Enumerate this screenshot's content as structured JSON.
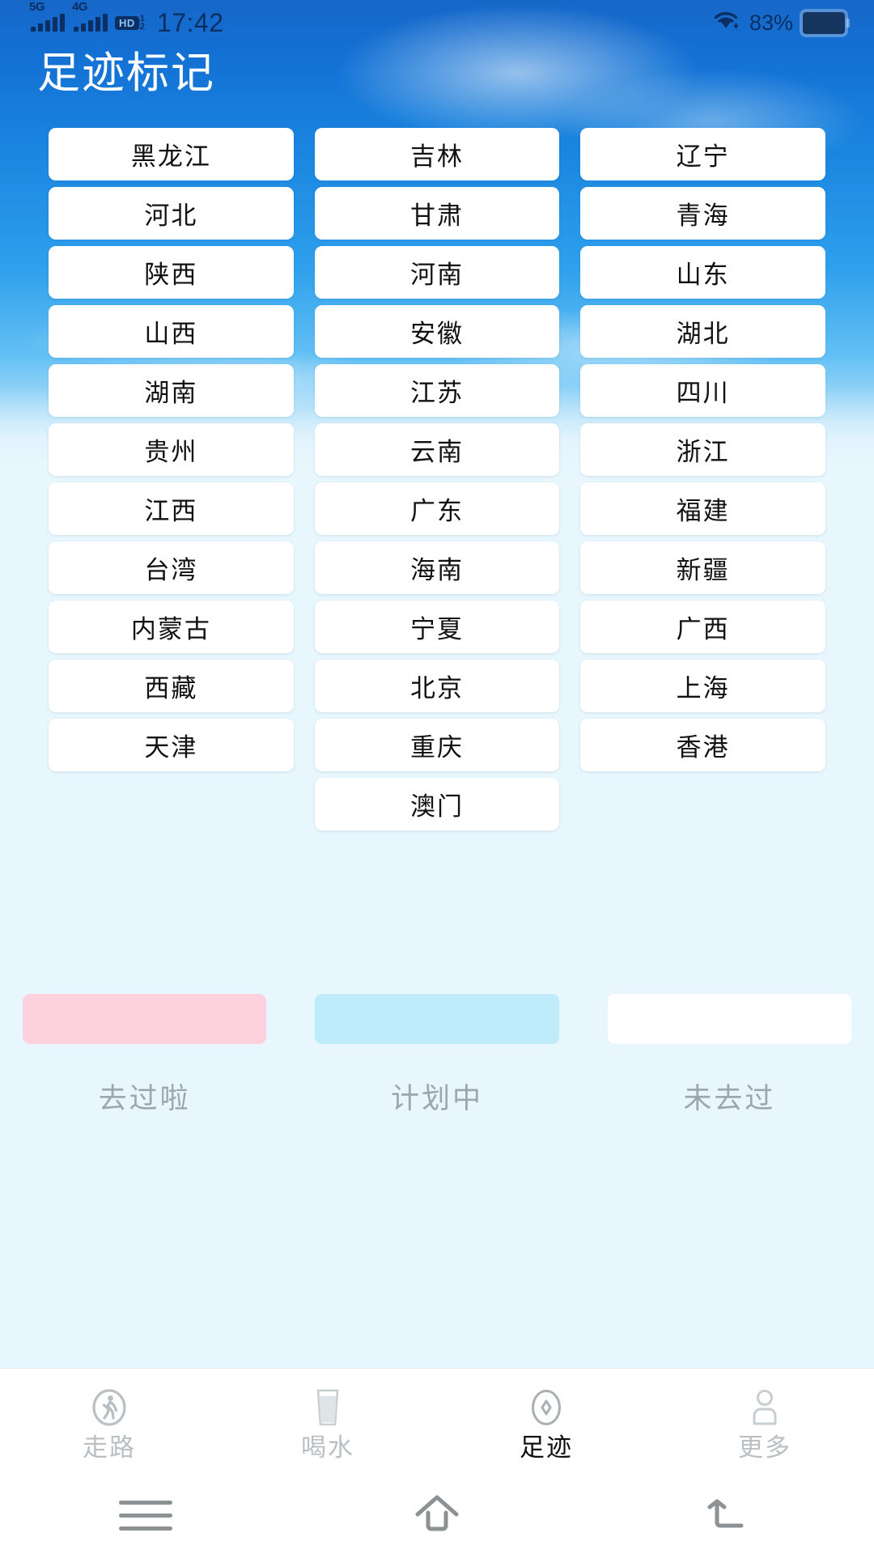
{
  "status_bar": {
    "network_5g": "5G",
    "network_4g": "4G",
    "hd_badge": "HD",
    "hd_sub_top": "1",
    "hd_sub_bottom": "2",
    "time": "17:42",
    "battery_percent": "83%",
    "wifi_icon": "wifi-icon",
    "battery_icon": "battery-icon"
  },
  "header": {
    "title": "足迹标记"
  },
  "grid": {
    "rows": [
      [
        {
          "label": "黑龙江",
          "state": "unvisited"
        },
        {
          "label": "吉林",
          "state": "unvisited"
        },
        {
          "label": "辽宁",
          "state": "unvisited"
        }
      ],
      [
        {
          "label": "河北",
          "state": "unvisited"
        },
        {
          "label": "甘肃",
          "state": "unvisited"
        },
        {
          "label": "青海",
          "state": "unvisited"
        }
      ],
      [
        {
          "label": "陕西",
          "state": "unvisited"
        },
        {
          "label": "河南",
          "state": "unvisited"
        },
        {
          "label": "山东",
          "state": "unvisited"
        }
      ],
      [
        {
          "label": "山西",
          "state": "unvisited"
        },
        {
          "label": "安徽",
          "state": "unvisited"
        },
        {
          "label": "湖北",
          "state": "unvisited"
        }
      ],
      [
        {
          "label": "湖南",
          "state": "unvisited"
        },
        {
          "label": "江苏",
          "state": "unvisited"
        },
        {
          "label": "四川",
          "state": "unvisited"
        }
      ],
      [
        {
          "label": "贵州",
          "state": "unvisited"
        },
        {
          "label": "云南",
          "state": "unvisited"
        },
        {
          "label": "浙江",
          "state": "unvisited"
        }
      ],
      [
        {
          "label": "江西",
          "state": "unvisited"
        },
        {
          "label": "广东",
          "state": "unvisited"
        },
        {
          "label": "福建",
          "state": "unvisited"
        }
      ],
      [
        {
          "label": "台湾",
          "state": "unvisited"
        },
        {
          "label": "海南",
          "state": "unvisited"
        },
        {
          "label": "新疆",
          "state": "unvisited"
        }
      ],
      [
        {
          "label": "内蒙古",
          "state": "unvisited"
        },
        {
          "label": "宁夏",
          "state": "unvisited"
        },
        {
          "label": "广西",
          "state": "unvisited"
        }
      ],
      [
        {
          "label": "西藏",
          "state": "unvisited"
        },
        {
          "label": "北京",
          "state": "unvisited"
        },
        {
          "label": "上海",
          "state": "unvisited"
        }
      ],
      [
        {
          "label": "天津",
          "state": "unvisited"
        },
        {
          "label": "重庆",
          "state": "unvisited"
        },
        {
          "label": "香港",
          "state": "unvisited"
        }
      ],
      [
        {
          "label": "",
          "state": "empty"
        },
        {
          "label": "澳门",
          "state": "unvisited"
        },
        {
          "label": "",
          "state": "empty"
        }
      ]
    ]
  },
  "legend": {
    "items": [
      {
        "label": "去过啦",
        "color": "#fdd2de",
        "swatch_class": "pink"
      },
      {
        "label": "计划中",
        "color": "#bfecfb",
        "swatch_class": "blue"
      },
      {
        "label": "未去过",
        "color": "#ffffff",
        "swatch_class": "white"
      }
    ]
  },
  "tabbar": {
    "items": [
      {
        "label": "走路",
        "icon": "walking-icon",
        "active": false
      },
      {
        "label": "喝水",
        "icon": "water-glass-icon",
        "active": false
      },
      {
        "label": "足迹",
        "icon": "footprint-icon",
        "active": true
      },
      {
        "label": "更多",
        "icon": "person-icon",
        "active": false
      }
    ]
  },
  "system_nav": {
    "recents_icon": "menu-icon",
    "home_icon": "home-icon",
    "back_icon": "back-icon"
  },
  "colors": {
    "sky_top": "#1667c8",
    "page_bg": "#e8f6fd",
    "visited": "#fdd2de",
    "planned": "#bfecfb",
    "unvisited": "#ffffff",
    "title_text": "#ffffff",
    "legend_text": "#9aa7ad"
  }
}
